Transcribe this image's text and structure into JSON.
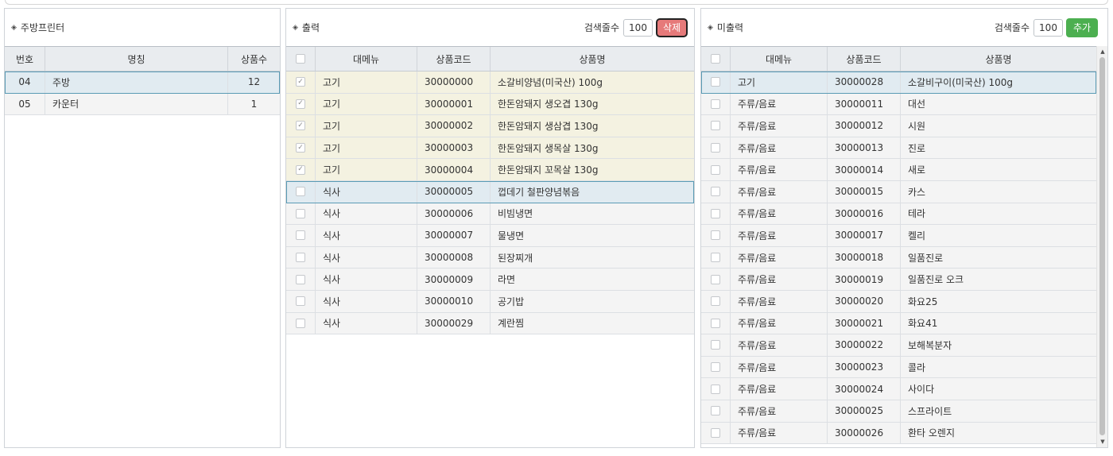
{
  "left_panel": {
    "title": "주방프린터",
    "columns": [
      "번호",
      "명칭",
      "상품수"
    ],
    "rows": [
      {
        "no": "04",
        "name": "주방",
        "count": "12",
        "selected": true
      },
      {
        "no": "05",
        "name": "카운터",
        "count": "1",
        "selected": false
      }
    ]
  },
  "middle_panel": {
    "title": "출력",
    "search_label": "검색줄수",
    "search_value": "100",
    "delete_label": "삭제",
    "columns": [
      "",
      "대메뉴",
      "상품코드",
      "상품명"
    ],
    "rows": [
      {
        "checked": true,
        "category": "고기",
        "code": "30000000",
        "name": "소갈비양념(미국산) 100g"
      },
      {
        "checked": true,
        "category": "고기",
        "code": "30000001",
        "name": "한돈암돼지 생오겹 130g"
      },
      {
        "checked": true,
        "category": "고기",
        "code": "30000002",
        "name": "한돈암돼지 생삼겹 130g"
      },
      {
        "checked": true,
        "category": "고기",
        "code": "30000003",
        "name": "한돈암돼지 생목살 130g"
      },
      {
        "checked": true,
        "category": "고기",
        "code": "30000004",
        "name": "한돈암돼지 꼬목살 130g"
      },
      {
        "checked": false,
        "selected": true,
        "category": "식사",
        "code": "30000005",
        "name": "껍데기 철판양념볶음"
      },
      {
        "checked": false,
        "category": "식사",
        "code": "30000006",
        "name": "비빔냉면"
      },
      {
        "checked": false,
        "category": "식사",
        "code": "30000007",
        "name": "물냉면"
      },
      {
        "checked": false,
        "category": "식사",
        "code": "30000008",
        "name": "된장찌개"
      },
      {
        "checked": false,
        "category": "식사",
        "code": "30000009",
        "name": "라면"
      },
      {
        "checked": false,
        "category": "식사",
        "code": "30000010",
        "name": "공기밥"
      },
      {
        "checked": false,
        "category": "식사",
        "code": "30000029",
        "name": "계란찜"
      }
    ]
  },
  "right_panel": {
    "title": "미출력",
    "search_label": "검색줄수",
    "search_value": "100",
    "add_label": "추가",
    "columns": [
      "",
      "대메뉴",
      "상품코드",
      "상품명"
    ],
    "rows": [
      {
        "selected": true,
        "category": "고기",
        "code": "30000028",
        "name": "소갈비구이(미국산) 100g"
      },
      {
        "category": "주류/음료",
        "code": "30000011",
        "name": "대선"
      },
      {
        "category": "주류/음료",
        "code": "30000012",
        "name": "시원"
      },
      {
        "category": "주류/음료",
        "code": "30000013",
        "name": "진로"
      },
      {
        "category": "주류/음료",
        "code": "30000014",
        "name": "새로"
      },
      {
        "category": "주류/음료",
        "code": "30000015",
        "name": "카스"
      },
      {
        "category": "주류/음료",
        "code": "30000016",
        "name": "테라"
      },
      {
        "category": "주류/음료",
        "code": "30000017",
        "name": "켈리"
      },
      {
        "category": "주류/음료",
        "code": "30000018",
        "name": "일품진로"
      },
      {
        "category": "주류/음료",
        "code": "30000019",
        "name": "일품진로 오크"
      },
      {
        "category": "주류/음료",
        "code": "30000020",
        "name": "화요25"
      },
      {
        "category": "주류/음료",
        "code": "30000021",
        "name": "화요41"
      },
      {
        "category": "주류/음료",
        "code": "30000022",
        "name": "보해복분자"
      },
      {
        "category": "주류/음료",
        "code": "30000023",
        "name": "콜라"
      },
      {
        "category": "주류/음료",
        "code": "30000024",
        "name": "사이다"
      },
      {
        "category": "주류/음료",
        "code": "30000025",
        "name": "스프라이트"
      },
      {
        "category": "주류/음료",
        "code": "30000026",
        "name": "환타 오렌지"
      }
    ]
  }
}
